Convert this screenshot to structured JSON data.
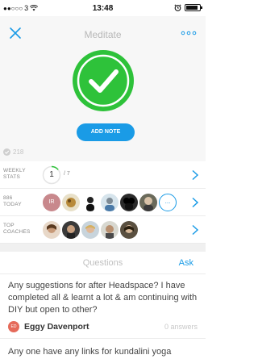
{
  "status_bar": {
    "carrier": "3",
    "time": "13:48",
    "battery_level": 0.85
  },
  "nav": {
    "title": "Meditate",
    "close_icon": "close-icon",
    "more_icon": "more-icon"
  },
  "hero": {
    "checkmark_icon": "checkmark-badge-icon",
    "add_note_label": "ADD NOTE",
    "count": "218",
    "count_icon": "check-circle-icon",
    "accent_color": "#1a9be6",
    "success_color": "#2ec23a"
  },
  "weekly_stats": {
    "label_line1": "WEEKLY",
    "label_line2": "STATS",
    "value": "1",
    "total": "/ 7",
    "progress": 0.14
  },
  "today": {
    "label_line1": "886",
    "label_line2": "TODAY",
    "first_initials": "IR",
    "more_label": "..."
  },
  "top_coaches": {
    "label_line1": "TOP",
    "label_line2": "COACHES"
  },
  "questions_header": {
    "title": "Questions",
    "ask_label": "Ask"
  },
  "questions": [
    {
      "text": "Any suggestions for after Headspace? I have completed all & learnt a lot & am continuing with DIY but open to other?",
      "author_initials": "ED",
      "author": "Eggy Davenport",
      "answers": "0 answers"
    },
    {
      "text": "Any one have any links for kundalini yoga"
    }
  ]
}
